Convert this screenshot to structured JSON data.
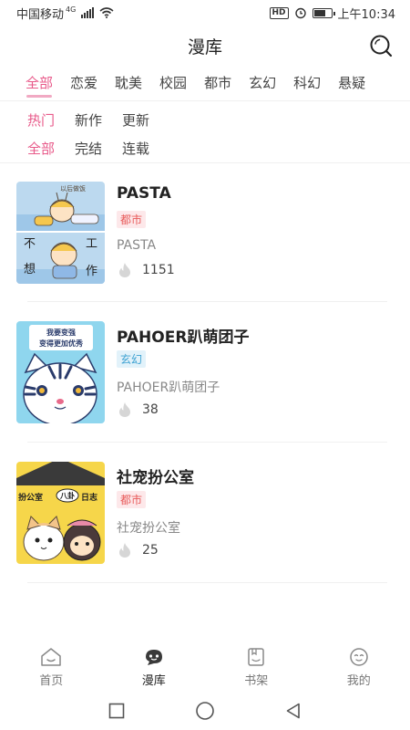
{
  "status_bar": {
    "carrier": "中国移动",
    "network": "4G",
    "hd_label": "HD",
    "time": "上午10:34",
    "battery_level": 0.6
  },
  "header": {
    "title": "漫库"
  },
  "categories": {
    "items": [
      "全部",
      "恋爱",
      "耽美",
      "校园",
      "都市",
      "玄幻",
      "科幻",
      "悬疑"
    ],
    "active": "全部"
  },
  "sort_filter": {
    "items": [
      "热门",
      "新作",
      "更新"
    ],
    "active": "热门"
  },
  "status_filter": {
    "items": [
      "全部",
      "完结",
      "连载"
    ],
    "active": "全部"
  },
  "comics": [
    {
      "title": "PASTA",
      "tag": "都市",
      "subtitle": "PASTA",
      "heat": "1151",
      "tag_color": "#e85a5a"
    },
    {
      "title": "PAHOER趴萌团子",
      "tag": "玄幻",
      "subtitle": "PAHOER趴萌团子",
      "heat": "38",
      "tag_color": "#3ea2d2"
    },
    {
      "title": "社宠扮公室",
      "tag": "都市",
      "subtitle": "社宠扮公室",
      "heat": "25",
      "tag_color": "#e85a5a"
    }
  ],
  "covers": {
    "pasta_top_text": "以后做饭",
    "pasta_bottom_chars": [
      "不",
      "工",
      "想",
      "作"
    ],
    "pahoer_banner": [
      "我要变强",
      "变得更加优秀"
    ],
    "office_sign": [
      "扮公室",
      "八卦",
      "日志"
    ]
  },
  "bottom_nav": {
    "items": [
      {
        "label": "首页",
        "icon": "home-icon"
      },
      {
        "label": "漫库",
        "icon": "comic-library-icon"
      },
      {
        "label": "书架",
        "icon": "bookshelf-icon"
      },
      {
        "label": "我的",
        "icon": "profile-icon"
      }
    ],
    "active": "漫库"
  },
  "colors": {
    "accent": "#e85a8a",
    "accent_light": "#f1a9c3"
  }
}
